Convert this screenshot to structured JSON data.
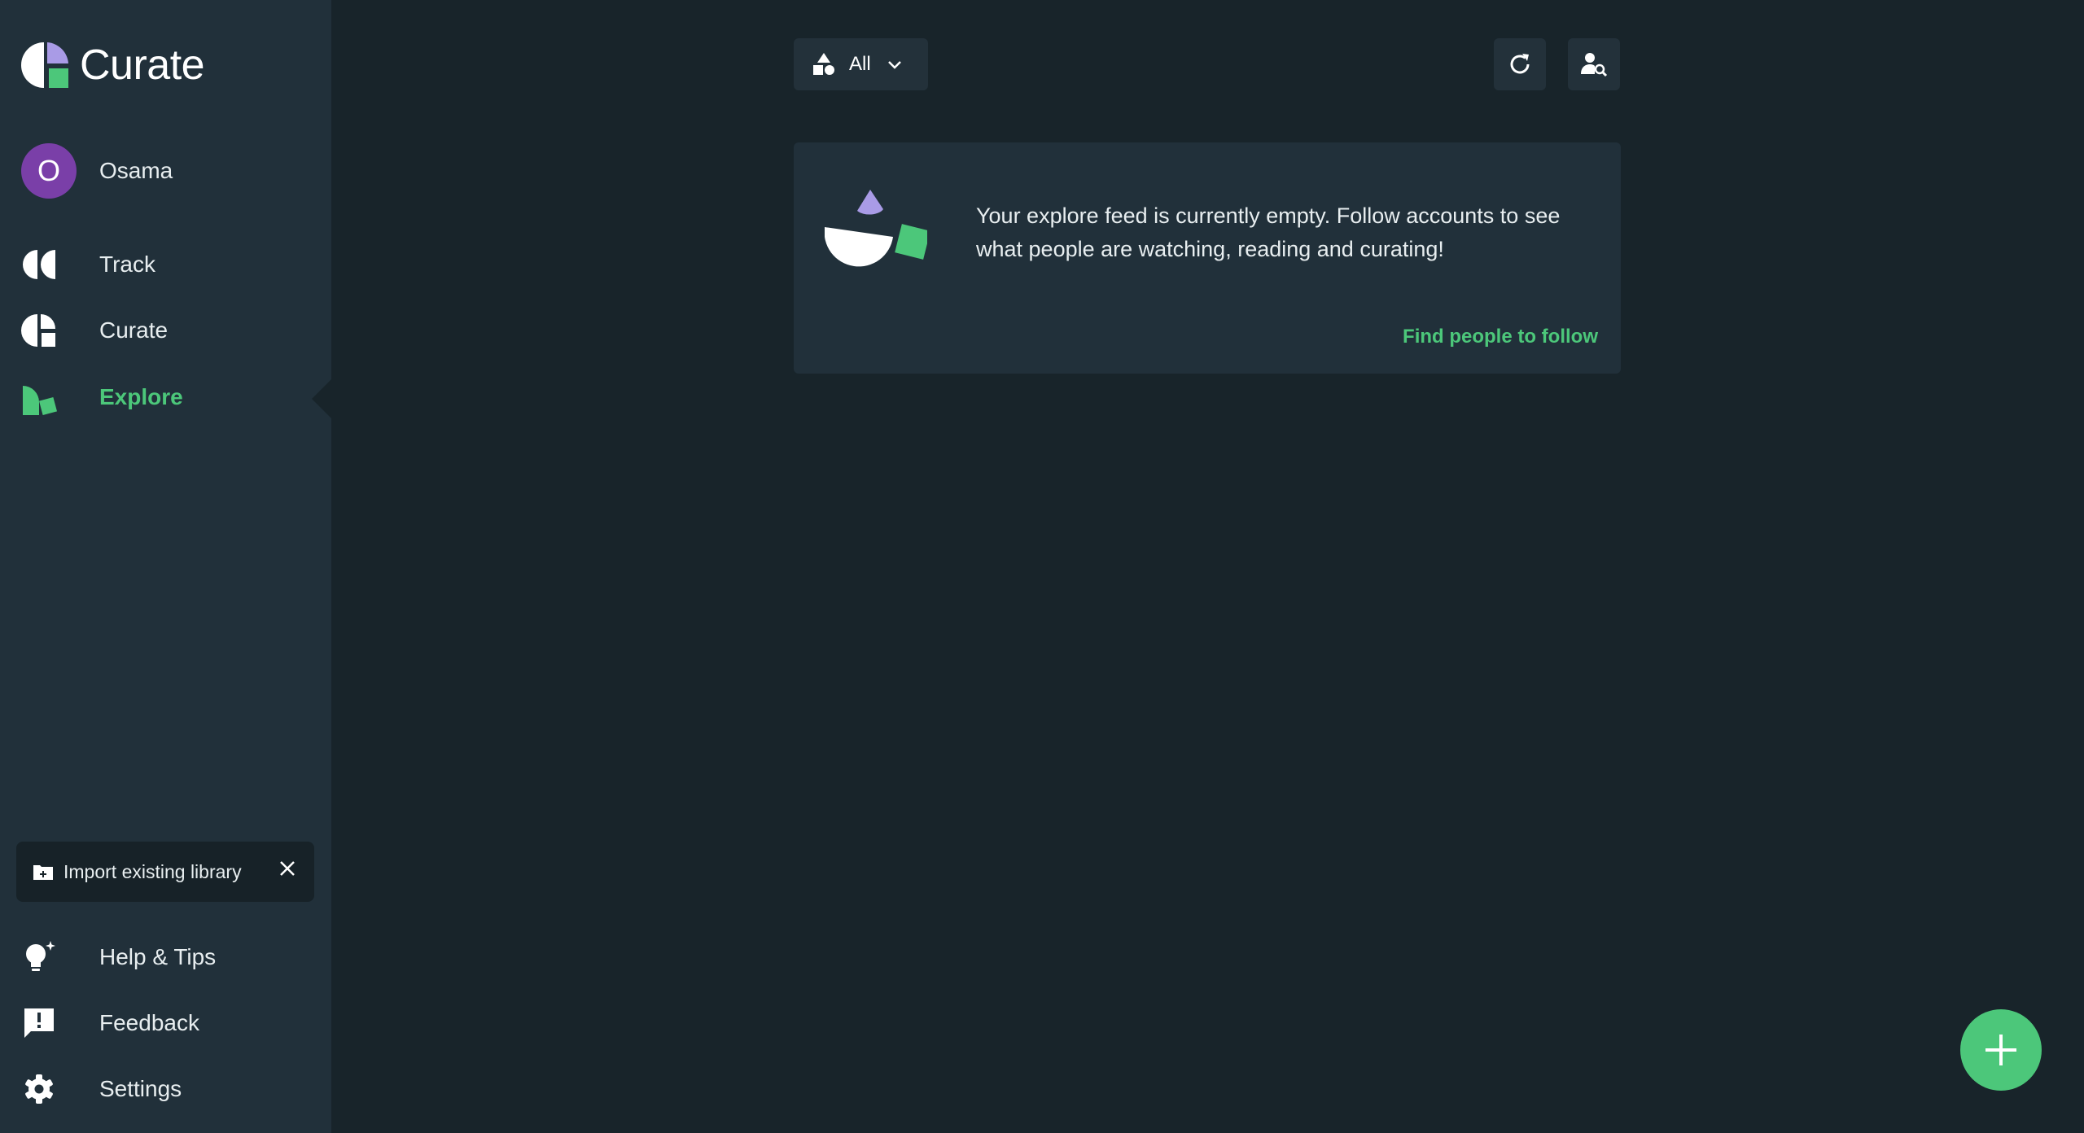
{
  "app": {
    "name": "Curate"
  },
  "user": {
    "initial": "O",
    "name": "Osama"
  },
  "nav": {
    "track": "Track",
    "curate": "Curate",
    "explore": "Explore",
    "help": "Help & Tips",
    "feedback": "Feedback",
    "settings": "Settings"
  },
  "import": {
    "label": "Import existing library"
  },
  "filter": {
    "selected": "All"
  },
  "feed": {
    "empty_message": "Your explore feed is currently empty. Follow accounts to see what people are watching, reading and curating!",
    "find_link": "Find people to follow"
  },
  "colors": {
    "accent": "#4cc77a",
    "purple": "#a99be6",
    "avatar": "#7a3fa8",
    "sidebar": "#21303a",
    "background": "#18242a"
  },
  "icons": {
    "logo": "curate-logo-icon",
    "track": "track-icon",
    "curate": "curate-icon",
    "explore": "explore-icon",
    "help": "lightbulb-icon",
    "feedback": "feedback-icon",
    "settings": "gear-icon",
    "refresh": "refresh-icon",
    "find_people": "person-search-icon",
    "add": "plus-icon"
  }
}
